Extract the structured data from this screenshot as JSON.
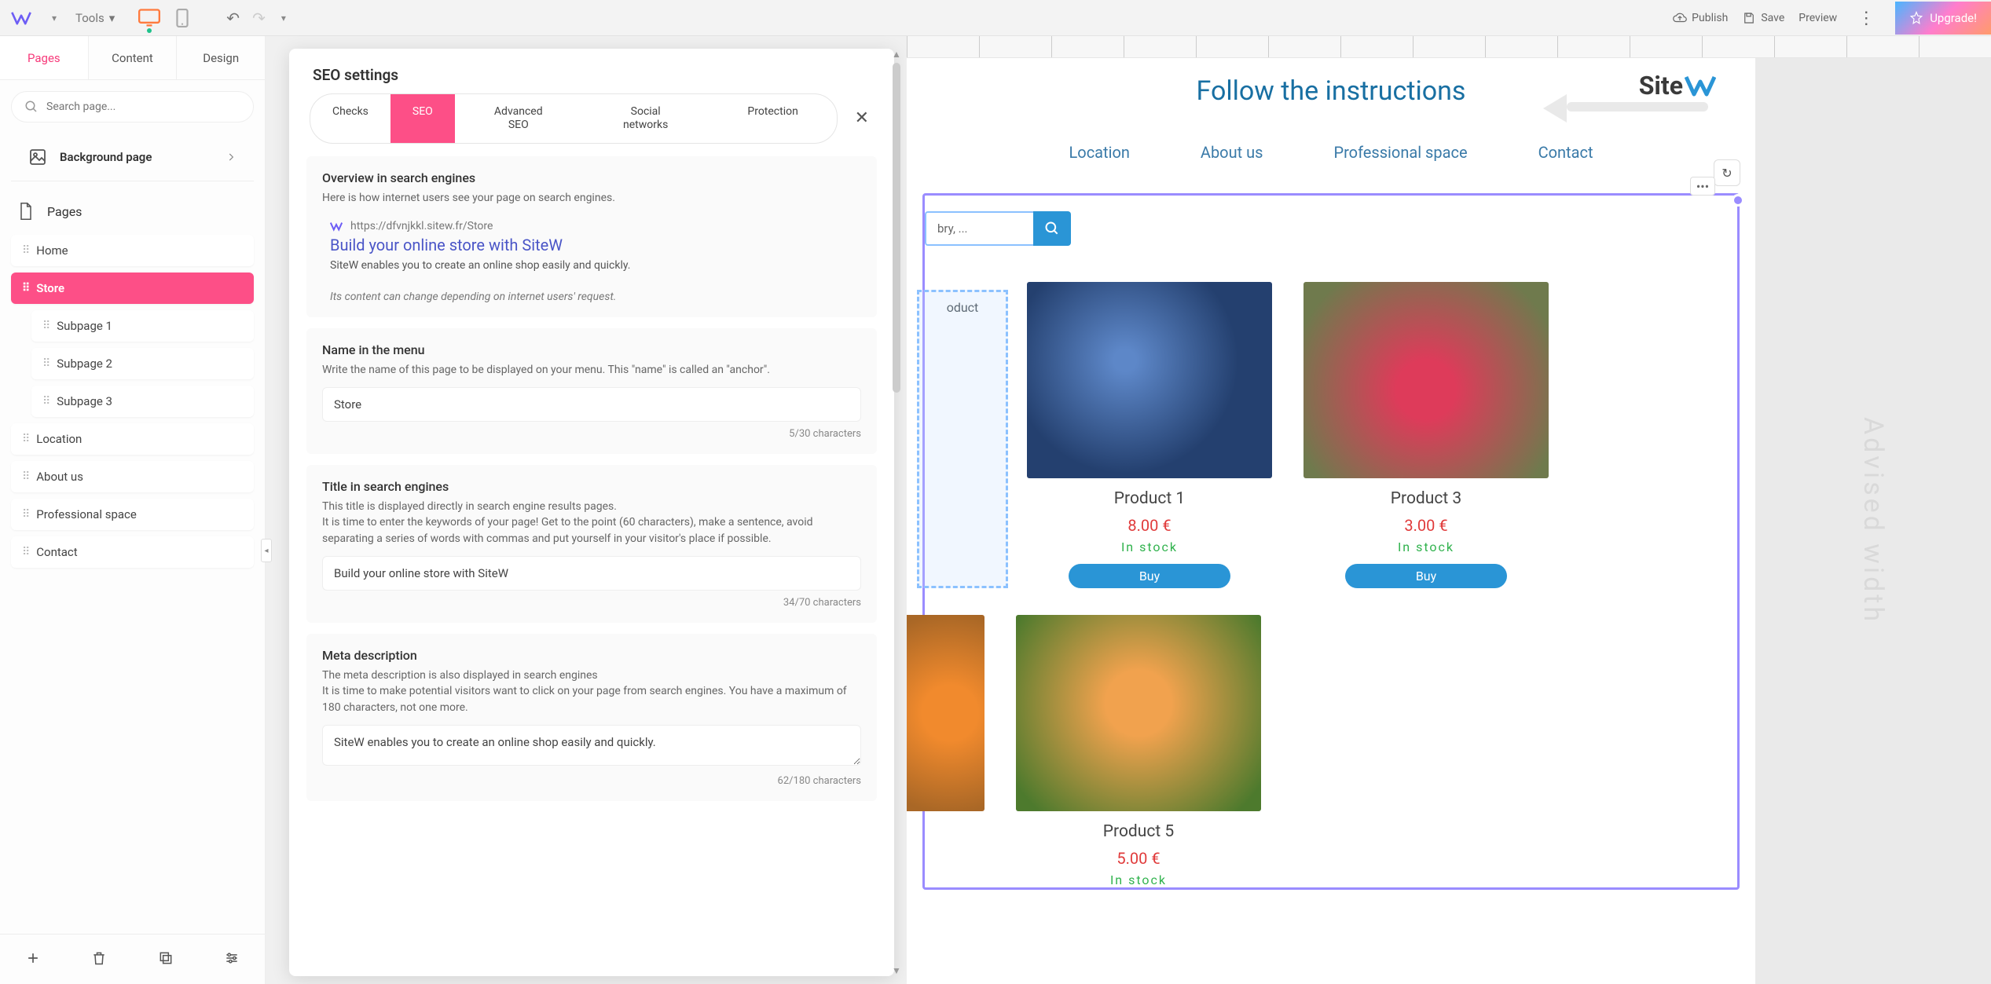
{
  "topbar": {
    "tools_label": "Tools",
    "publish": "Publish",
    "save": "Save",
    "preview": "Preview",
    "upgrade": "Upgrade!"
  },
  "sidebar": {
    "tabs": [
      "Pages",
      "Content",
      "Design"
    ],
    "search_placeholder": "Search page...",
    "background_label": "Background page",
    "pages_label": "Pages",
    "pages": [
      {
        "label": "Home",
        "active": false
      },
      {
        "label": "Store",
        "active": true
      },
      {
        "label": "Subpage 1",
        "sub": true
      },
      {
        "label": "Subpage 2",
        "sub": true
      },
      {
        "label": "Subpage 3",
        "sub": true
      },
      {
        "label": "Location"
      },
      {
        "label": "About us"
      },
      {
        "label": "Professional space"
      },
      {
        "label": "Contact"
      }
    ]
  },
  "seo": {
    "panel_title": "SEO settings",
    "tabs": {
      "checks": "Checks",
      "seo": "SEO",
      "adv1": "Advanced",
      "adv2": "SEO",
      "soc1": "Social",
      "soc2": "networks",
      "protection": "Protection"
    },
    "overview": {
      "title": "Overview in search engines",
      "sub": "Here is how internet users see your page on search engines.",
      "url": "https://dfvnjkkl.sitew.fr/Store",
      "serp_title": "Build your online store with SiteW",
      "serp_desc": "SiteW enables you to create an online shop easily and quickly.",
      "note": "Its content can change depending on internet users' request."
    },
    "name": {
      "title": "Name in the menu",
      "sub": "Write the name of this page to be displayed on your menu. This \"name\" is called an \"anchor\".",
      "value": "Store",
      "count": "5/30 characters"
    },
    "title": {
      "title": "Title in search engines",
      "sub1": "This title is displayed directly in search engine results pages.",
      "sub2": "It is time to enter the keywords of your page! Get to the point (60 characters), make a sentence, avoid separating a series of words with commas and put yourself in your visitor's place if possible.",
      "value": "Build your online store with SiteW",
      "count": "34/70 characters"
    },
    "meta": {
      "title": "Meta description",
      "sub1": "The meta description is also displayed in search engines",
      "sub2": "It is time to make potential visitors want to click on your page from search engines. You have a maximum of 180 characters, not one more.",
      "value": "SiteW enables you to create an online shop easily and quickly.",
      "count": "62/180 characters"
    }
  },
  "canvas": {
    "page_title": "Follow the instructions",
    "brand": "Site",
    "nav": [
      "Location",
      "About us",
      "Professional space",
      "Contact"
    ],
    "search_hint": "bry, ...",
    "drop_label": "oduct",
    "advised": "Advised width",
    "buy": "Buy",
    "in_stock": "In stock",
    "products": [
      {
        "name": "Product 1",
        "price": "8.00 €",
        "imgClass": "blue"
      },
      {
        "name": "Product 3",
        "price": "3.00 €",
        "imgClass": "rasp"
      },
      {
        "name": "Product 5",
        "price": "5.00 €",
        "imgClass": "peach"
      }
    ]
  }
}
